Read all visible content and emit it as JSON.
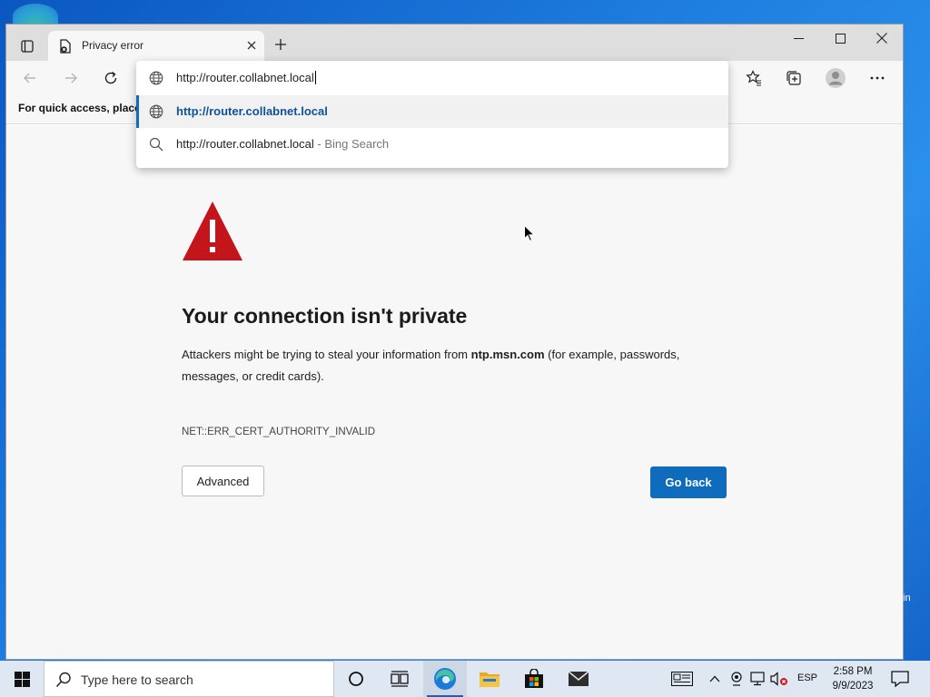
{
  "browser": {
    "tab_title": "Privacy error",
    "favorites_bar_text": "For quick access, place y",
    "address": {
      "input_value": "http://router.collabnet.local",
      "suggestions": [
        {
          "text": "http://router.collabnet.local",
          "suffix": "",
          "icon": "globe-icon",
          "selected": true
        },
        {
          "text": "http://router.collabnet.local",
          "suffix": " - Bing Search",
          "icon": "search-icon",
          "selected": false
        }
      ]
    }
  },
  "page": {
    "title": "Your connection isn't private",
    "desc_prefix": "Attackers might be trying to steal your information from ",
    "desc_host": "ntp.msn.com",
    "desc_suffix": " (for example, passwords, messages, or credit cards).",
    "error_code": "NET::ERR_CERT_AUTHORITY_INVALID",
    "advanced_label": "Advanced",
    "goback_label": "Go back"
  },
  "taskbar": {
    "search_placeholder": "Type here to search",
    "language": "ESP",
    "time": "2:58 PM",
    "date": "9/9/2023"
  },
  "desktop": {
    "edge_text": "in"
  },
  "colors": {
    "accent": "#0f6cbd",
    "warning": "#c4151c"
  }
}
